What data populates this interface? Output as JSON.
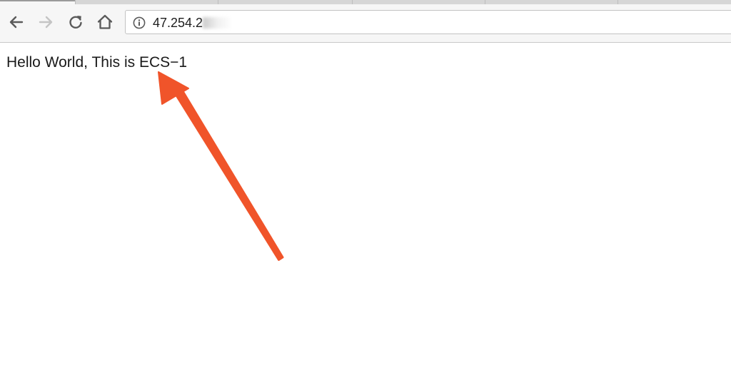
{
  "browser": {
    "tabs": [
      {
        "label": "",
        "active": true
      },
      {
        "label": "",
        "active": false
      },
      {
        "label": "",
        "active": false
      },
      {
        "label": "",
        "active": false
      },
      {
        "label": "",
        "active": false
      }
    ],
    "address_bar": {
      "url_visible": "47.254.2",
      "url_obscured": true
    },
    "icons": {
      "back": "back-arrow-icon",
      "forward": "forward-arrow-icon",
      "reload": "reload-icon",
      "home": "home-icon",
      "info": "info-icon"
    }
  },
  "page": {
    "body_text": "Hello World, This is ECS−1"
  },
  "annotation": {
    "type": "arrow",
    "color": "#f0542a"
  },
  "colors": {
    "toolbar_bg": "#f6f6f6",
    "icon_active": "#5a5a5a",
    "icon_disabled": "#bdbdbd",
    "text": "#1a1a1a"
  }
}
